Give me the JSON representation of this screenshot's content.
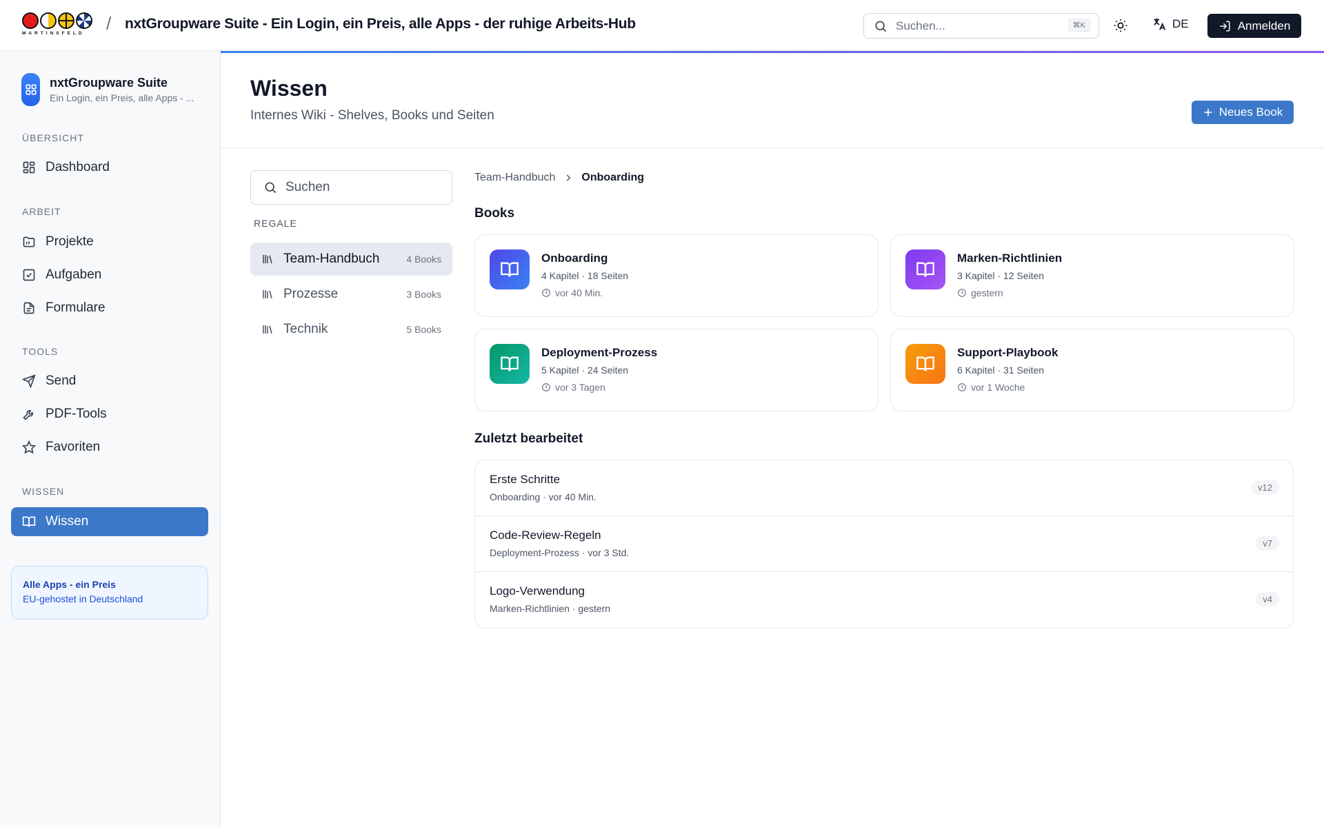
{
  "header": {
    "brand_wordmark": "MARTINSFELD",
    "separator": "/",
    "title": "nxtGroupware Suite - Ein Login, ein Preis, alle Apps - der ruhige Arbeits-Hub",
    "search_placeholder": "Suchen...",
    "search_shortcut": "⌘K",
    "language": "DE",
    "login_label": "Anmelden"
  },
  "sidebar": {
    "brand_name": "nxtGroupware Suite",
    "brand_sub": "Ein Login, ein Preis, alle Apps - ...",
    "sections": [
      {
        "label": "ÜBERSICHT",
        "items": [
          {
            "label": "Dashboard",
            "icon": "dashboard-icon"
          }
        ]
      },
      {
        "label": "ARBEIT",
        "items": [
          {
            "label": "Projekte",
            "icon": "folder-icon"
          },
          {
            "label": "Aufgaben",
            "icon": "checkbox-icon"
          },
          {
            "label": "Formulare",
            "icon": "document-icon"
          }
        ]
      },
      {
        "label": "TOOLS",
        "items": [
          {
            "label": "Send",
            "icon": "send-icon"
          },
          {
            "label": "PDF-Tools",
            "icon": "wrench-icon"
          },
          {
            "label": "Favoriten",
            "icon": "star-icon"
          }
        ]
      },
      {
        "label": "WISSEN",
        "items": [
          {
            "label": "Wissen",
            "icon": "book-icon",
            "active": true
          }
        ]
      }
    ],
    "promo_title": "Alle Apps - ein Preis",
    "promo_sub": "EU-gehostet in Deutschland"
  },
  "page": {
    "title": "Wissen",
    "subtitle": "Internes Wiki - Shelves, Books und Seiten",
    "new_book_label": "Neues Book"
  },
  "shelves": {
    "search_placeholder": "Suchen",
    "label": "REGALE",
    "items": [
      {
        "name": "Team-Handbuch",
        "count": "4 Books",
        "active": true
      },
      {
        "name": "Prozesse",
        "count": "3 Books"
      },
      {
        "name": "Technik",
        "count": "5 Books"
      }
    ]
  },
  "breadcrumb": {
    "parent": "Team-Handbuch",
    "current": "Onboarding"
  },
  "books": {
    "heading": "Books",
    "items": [
      {
        "title": "Onboarding",
        "meta": "4 Kapitel · 18 Seiten",
        "time": "vor 40 Min.",
        "color": "#3b5bdb"
      },
      {
        "title": "Marken-Richtlinien",
        "meta": "3 Kapitel · 12 Seiten",
        "time": "gestern",
        "color": "#8b3fe0"
      },
      {
        "title": "Deployment-Prozess",
        "meta": "5 Kapitel · 24 Seiten",
        "time": "vor 3 Tagen",
        "color": "#10a37f"
      },
      {
        "title": "Support-Playbook",
        "meta": "6 Kapitel · 31 Seiten",
        "time": "vor 1 Woche",
        "color": "#f97316"
      }
    ]
  },
  "recent": {
    "heading": "Zuletzt bearbeitet",
    "items": [
      {
        "title": "Erste Schritte",
        "sub": "Onboarding · vor 40 Min.",
        "version": "v12"
      },
      {
        "title": "Code-Review-Regeln",
        "sub": "Deployment-Prozess · vor 3 Std.",
        "version": "v7"
      },
      {
        "title": "Logo-Verwendung",
        "sub": "Marken-Richtlinien · gestern",
        "version": "v4"
      }
    ]
  },
  "colors": {
    "accent": "#3b78c9",
    "dark": "#111827"
  }
}
